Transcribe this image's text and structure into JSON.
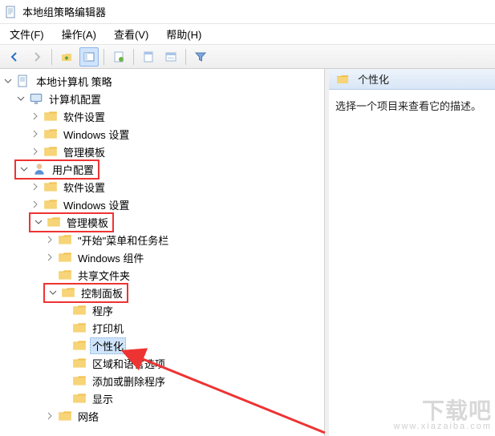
{
  "title": "本地组策略编辑器",
  "menu": {
    "file": "文件(F)",
    "action": "操作(A)",
    "view": "查看(V)",
    "help": "帮助(H)"
  },
  "tree_root": "本地计算机 策略",
  "computer_config": {
    "label": "计算机配置",
    "software": "软件设置",
    "windows": "Windows 设置",
    "admin": "管理模板"
  },
  "user_config": {
    "label": "用户配置",
    "software": "软件设置",
    "windows": "Windows 设置",
    "admin": {
      "label": "管理模板",
      "start": "\"开始\"菜单和任务栏",
      "wincomp": "Windows 组件",
      "shared": "共享文件夹",
      "control_panel": {
        "label": "控制面板",
        "programs": "程序",
        "printers": "打印机",
        "personalization": "个性化",
        "region": "区域和语言选项",
        "addremove": "添加或删除程序",
        "display": "显示"
      },
      "network": "网络"
    }
  },
  "right": {
    "header": "个性化",
    "body": "选择一个项目来查看它的描述。"
  },
  "watermark": {
    "big": "下载吧",
    "small": "www.xiazaiba.com"
  }
}
